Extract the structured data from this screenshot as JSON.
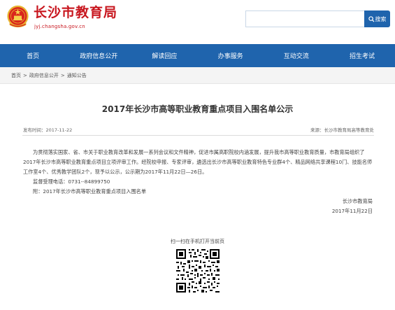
{
  "header": {
    "site_title": "长沙市教育局",
    "site_domain": "jyj.changsha.gov.cn",
    "emblem_icon": "national-emblem-icon"
  },
  "search": {
    "placeholder": "",
    "button_label": "搜索",
    "icon": "search-icon",
    "accent_color": "#1f64ad"
  },
  "nav": {
    "items": [
      {
        "label": "首页"
      },
      {
        "label": "政府信息公开"
      },
      {
        "label": "解读回应"
      },
      {
        "label": "办事服务"
      },
      {
        "label": "互动交流"
      },
      {
        "label": "招生考试"
      }
    ],
    "background_color": "#1f64ad"
  },
  "breadcrumb": {
    "items": [
      "首页",
      "政府信息公开",
      "通知公告"
    ],
    "separator": ">"
  },
  "article": {
    "title": "2017年长沙市高等职业教育重点项目入围名单公示",
    "date": "发布时间：2017-11-22",
    "source": "来源：长沙市教育局高等教育处",
    "paragraphs": {
      "p1": "为贯彻落实国家、省、市关于职业教育改革和发展一系列会议和文件精神，促进市属高职院校内涵发展，提升我市高等职业教育质量，市教育局组织了2017年长沙市高等职业教育重点项目立项评审工作。经院校申报、专家评审，遴选出长沙市高等职业教育特色专业群4个、精品网络共享课程10门、技能名师工作室4个、优秀教学团队2个，现予以公示，公示期为2017年11月22日—26日。",
      "p2": "监督受理电话：0731--84899750",
      "p3": "附：2017年长沙市高等职业教育重点项目入围名单",
      "sign_org": "长沙市教育局",
      "sign_date": "2017年11月22日"
    }
  },
  "qr": {
    "caption": "扫一扫在手机打开当前页",
    "icon": "qr-code-icon"
  }
}
